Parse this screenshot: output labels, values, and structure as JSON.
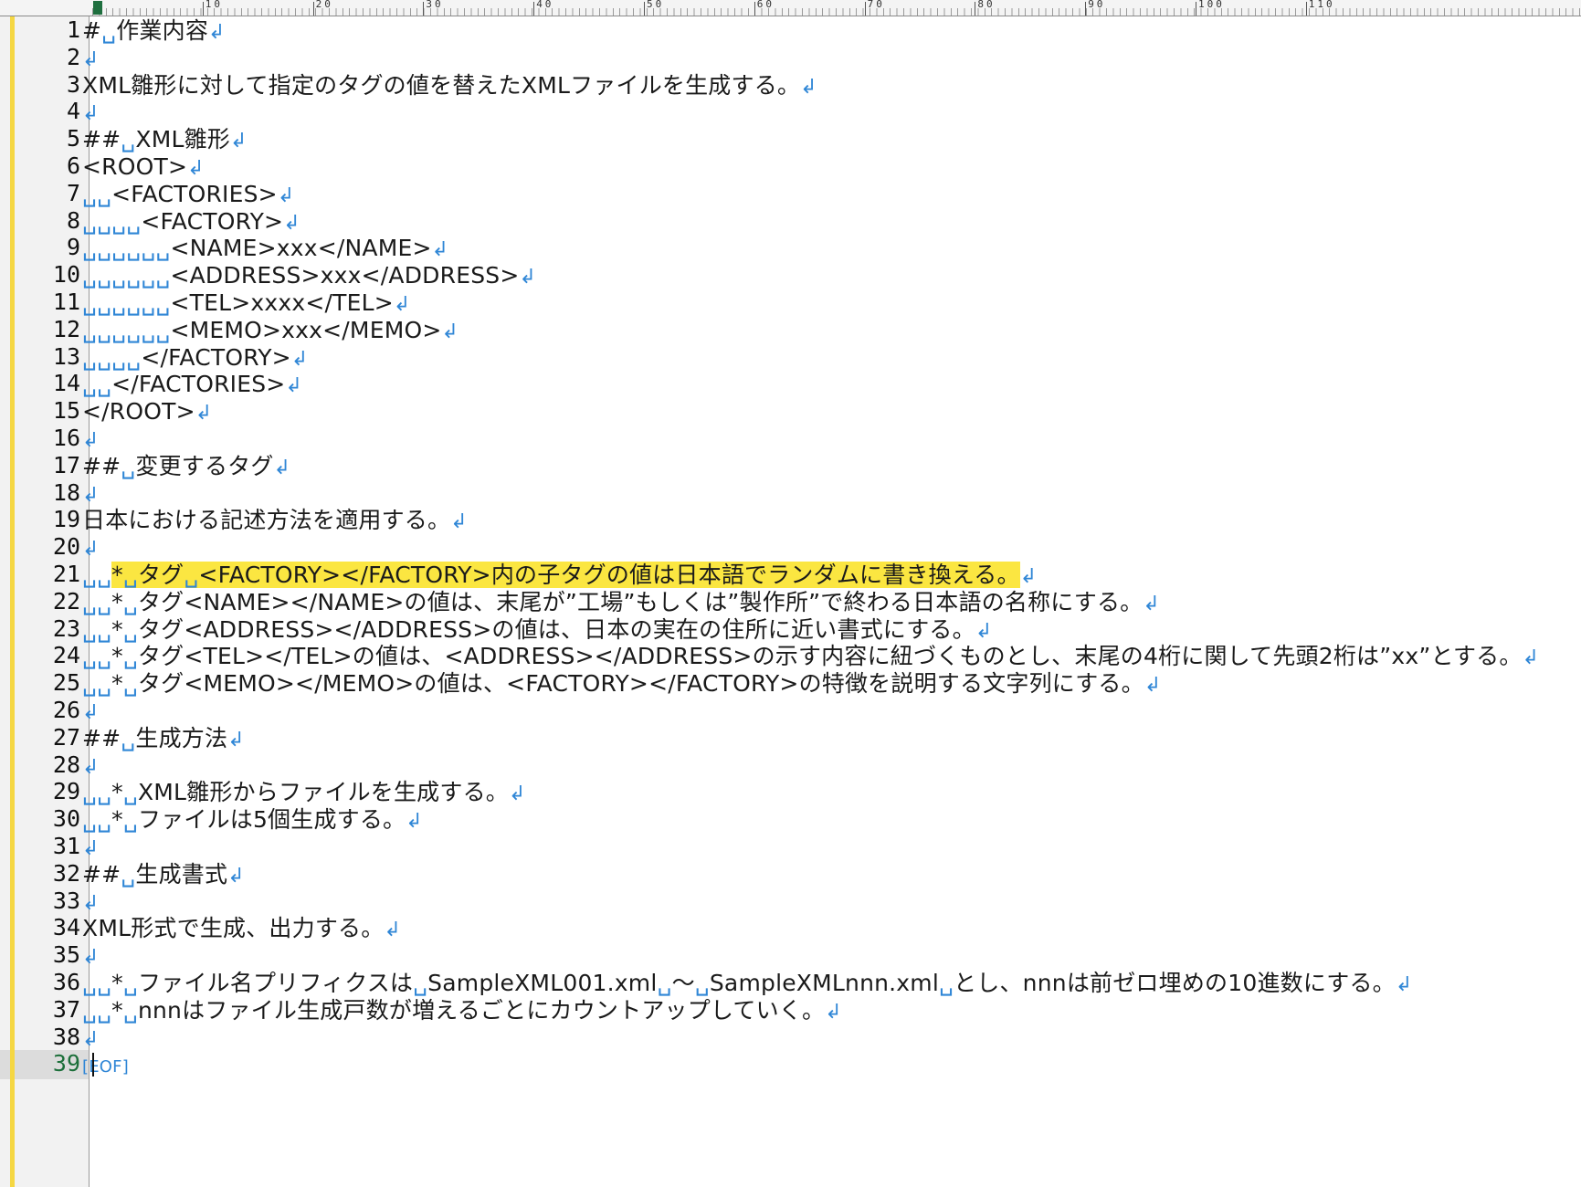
{
  "editor": {
    "ruler": {
      "labels": [
        "10",
        "20",
        "30",
        "40",
        "50",
        "60",
        "70",
        "80",
        "90",
        "100",
        "110"
      ]
    },
    "eol_mark": "↲",
    "eof_mark": "[EOF]",
    "current_line": 39,
    "highlight_color": "#fbe641",
    "change_bar_color": "#f5d743",
    "lines": [
      {
        "n": "1",
        "text": "#␣作業内容"
      },
      {
        "n": "2",
        "text": ""
      },
      {
        "n": "3",
        "text": "XML雛形に対して指定のタグの値を替えたXMLファイルを生成する。"
      },
      {
        "n": "4",
        "text": ""
      },
      {
        "n": "5",
        "text": "##␣XML雛形"
      },
      {
        "n": "6",
        "text": "<ROOT>"
      },
      {
        "n": "7",
        "text": "␣␣<FACTORIES>"
      },
      {
        "n": "8",
        "text": "␣␣␣␣<FACTORY>"
      },
      {
        "n": "9",
        "text": "␣␣␣␣␣␣<NAME>xxx</NAME>"
      },
      {
        "n": "10",
        "text": "␣␣␣␣␣␣<ADDRESS>xxx</ADDRESS>"
      },
      {
        "n": "11",
        "text": "␣␣␣␣␣␣<TEL>xxxx</TEL>"
      },
      {
        "n": "12",
        "text": "␣␣␣␣␣␣<MEMO>xxx</MEMO>"
      },
      {
        "n": "13",
        "text": "␣␣␣␣</FACTORY>"
      },
      {
        "n": "14",
        "text": "␣␣</FACTORIES>"
      },
      {
        "n": "15",
        "text": "</ROOT>"
      },
      {
        "n": "16",
        "text": ""
      },
      {
        "n": "17",
        "text": "##␣変更するタグ"
      },
      {
        "n": "18",
        "text": ""
      },
      {
        "n": "19",
        "text": "日本における記述方法を適用する。"
      },
      {
        "n": "20",
        "text": ""
      },
      {
        "n": "21",
        "text": "␣␣*␣タグ␣<FACTORY></FACTORY>内の子タグの値は日本語でランダムに書き換える。"
      },
      {
        "n": "22",
        "text": "␣␣*␣タグ<NAME></NAME>の値は、末尾が”工場”もしくは”製作所”で終わる日本語の名称にする。"
      },
      {
        "n": "23",
        "text": "␣␣*␣タグ<ADDRESS></ADDRESS>の値は、日本の実在の住所に近い書式にする。"
      },
      {
        "n": "24",
        "text": "␣␣*␣タグ<TEL></TEL>の値は、<ADDRESS></ADDRESS>の示す内容に紐づくものとし、末尾の4桁に関して先頭2桁は”xx”とする。"
      },
      {
        "n": "25",
        "text": "␣␣*␣タグ<MEMO></MEMO>の値は、<FACTORY></FACTORY>の特徴を説明する文字列にする。"
      },
      {
        "n": "26",
        "text": ""
      },
      {
        "n": "27",
        "text": "##␣生成方法"
      },
      {
        "n": "28",
        "text": ""
      },
      {
        "n": "29",
        "text": "␣␣*␣XML雛形からファイルを生成する。"
      },
      {
        "n": "30",
        "text": "␣␣*␣ファイルは5個生成する。"
      },
      {
        "n": "31",
        "text": ""
      },
      {
        "n": "32",
        "text": "##␣生成書式"
      },
      {
        "n": "33",
        "text": ""
      },
      {
        "n": "34",
        "text": "XML形式で生成、出力する。"
      },
      {
        "n": "35",
        "text": ""
      },
      {
        "n": "36",
        "text": "␣␣*␣ファイル名プリフィクスは␣SampleXML001.xml␣～␣SampleXMLnnn.xml␣とし、nnnは前ゼロ埋めの10進数にする。"
      },
      {
        "n": "37",
        "text": "␣␣*␣nnnはファイル生成戸数が増えるごとにカウントアップしていく。"
      },
      {
        "n": "38",
        "text": ""
      },
      {
        "n": "39",
        "text": ""
      }
    ]
  }
}
